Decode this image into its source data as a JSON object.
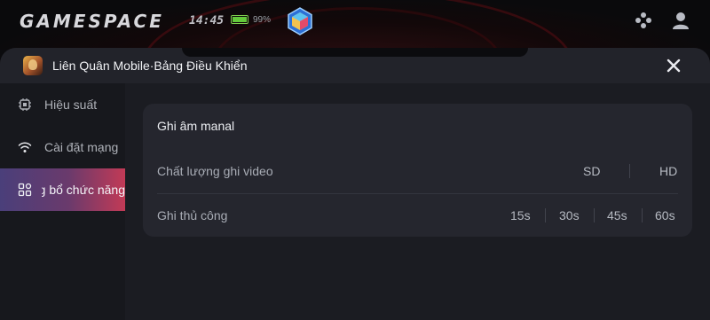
{
  "status_bar": {
    "brand": "GAMESPACE",
    "time": "14:45",
    "battery_percent": "99%",
    "battery_level": 0.99,
    "battery_color": "#63c93b"
  },
  "panel": {
    "title": "Liên Quân Mobile·Bảng Điều Khiển"
  },
  "sidebar": {
    "items": [
      {
        "label": "Hiệu suất",
        "icon": "cpu-chip-icon"
      },
      {
        "label": "Cài đặt mạng",
        "icon": "wifi-icon"
      },
      {
        "label": "Bổ sung bổ chức năng",
        "icon": "apps-grid-icon",
        "active": true
      }
    ],
    "active_gradient": [
      "#4a3f7a",
      "#c23a56"
    ]
  },
  "card": {
    "title": "Ghi âm manal",
    "rows": [
      {
        "label": "Chất lượng ghi video",
        "options": [
          "SD",
          "HD"
        ]
      },
      {
        "label": "Ghi thủ công",
        "options": [
          "15s",
          "30s",
          "45s",
          "60s"
        ]
      }
    ]
  }
}
